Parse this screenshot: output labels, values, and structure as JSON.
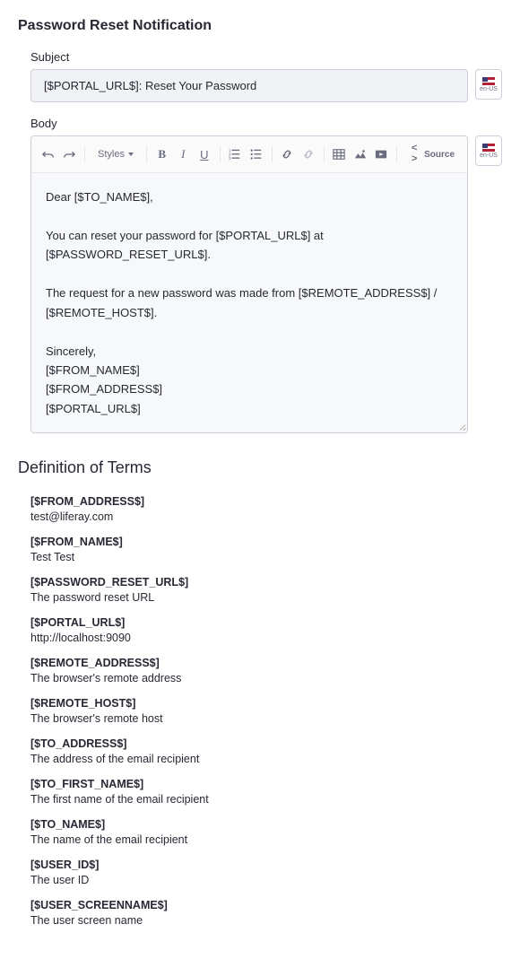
{
  "section_title": "Password Reset Notification",
  "subject": {
    "label": "Subject",
    "value": "[$PORTAL_URL$]: Reset Your Password"
  },
  "body": {
    "label": "Body",
    "content": "Dear [$TO_NAME$],\n\nYou can reset your password for [$PORTAL_URL$] at [$PASSWORD_RESET_URL$].\n\nThe request for a new password was made from [$REMOTE_ADDRESS$] / [$REMOTE_HOST$].\n\nSincerely,\n[$FROM_NAME$]\n[$FROM_ADDRESS$]\n[$PORTAL_URL$]"
  },
  "toolbar": {
    "styles_label": "Styles",
    "source_label": "Source"
  },
  "locale": {
    "code": "en-US"
  },
  "definitions": {
    "title": "Definition of Terms",
    "items": [
      {
        "key": "[$FROM_ADDRESS$]",
        "desc": "test@liferay.com"
      },
      {
        "key": "[$FROM_NAME$]",
        "desc": "Test Test"
      },
      {
        "key": "[$PASSWORD_RESET_URL$]",
        "desc": "The password reset URL"
      },
      {
        "key": "[$PORTAL_URL$]",
        "desc": "http://localhost:9090"
      },
      {
        "key": "[$REMOTE_ADDRESS$]",
        "desc": "The browser's remote address"
      },
      {
        "key": "[$REMOTE_HOST$]",
        "desc": "The browser's remote host"
      },
      {
        "key": "[$TO_ADDRESS$]",
        "desc": "The address of the email recipient"
      },
      {
        "key": "[$TO_FIRST_NAME$]",
        "desc": "The first name of the email recipient"
      },
      {
        "key": "[$TO_NAME$]",
        "desc": "The name of the email recipient"
      },
      {
        "key": "[$USER_ID$]",
        "desc": "The user ID"
      },
      {
        "key": "[$USER_SCREENNAME$]",
        "desc": "The user screen name"
      }
    ]
  }
}
